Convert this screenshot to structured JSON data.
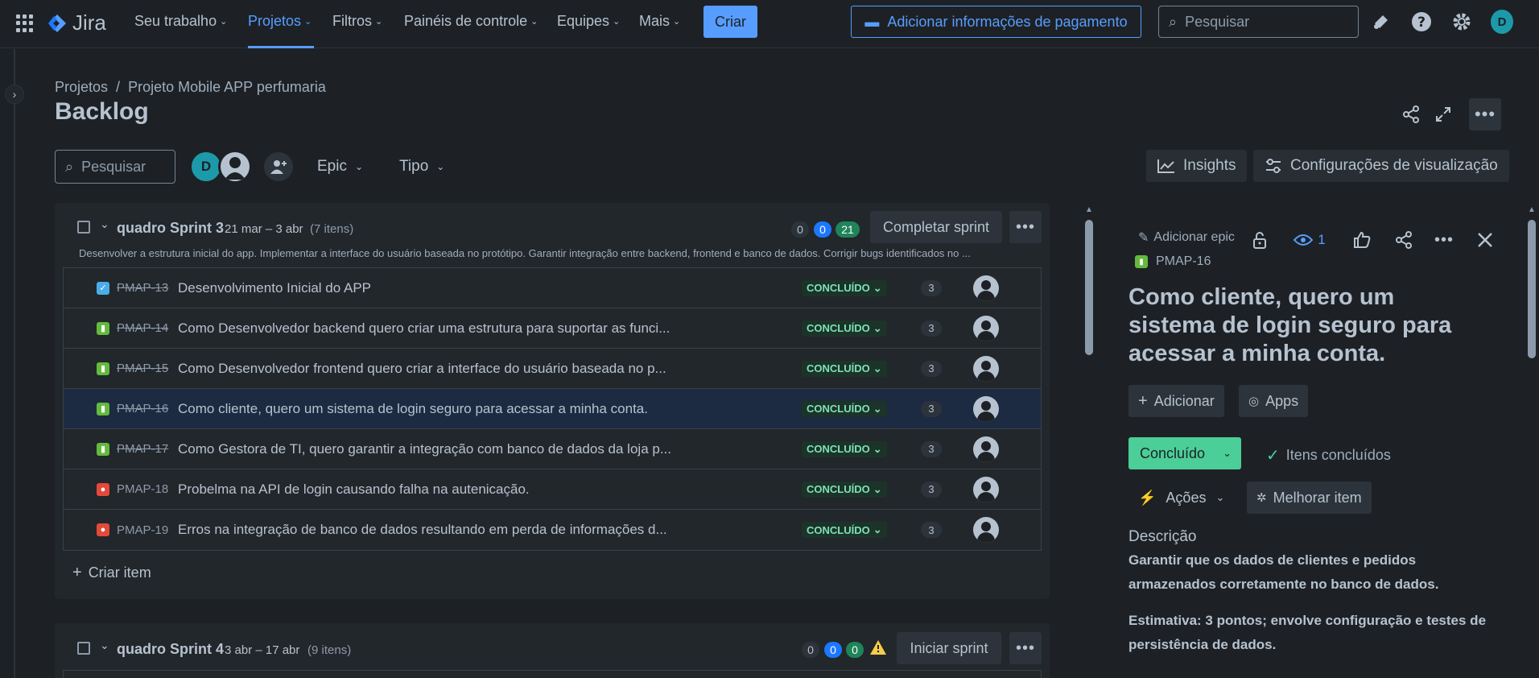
{
  "topbar": {
    "app_name": "Jira",
    "nav": [
      {
        "label": "Seu trabalho"
      },
      {
        "label": "Projetos"
      },
      {
        "label": "Filtros"
      },
      {
        "label": "Painéis de controle"
      },
      {
        "label": "Equipes"
      },
      {
        "label": "Mais"
      }
    ],
    "create_label": "Criar",
    "payment_label": "Adicionar informações de pagamento",
    "search_placeholder": "Pesquisar",
    "user_initial": "D"
  },
  "breadcrumb": {
    "root": "Projetos",
    "sep": "/",
    "project": "Projeto Mobile APP perfumaria"
  },
  "page_title": "Backlog",
  "filters": {
    "search_placeholder": "Pesquisar",
    "avatar_initial": "D",
    "epic_label": "Epic",
    "type_label": "Tipo",
    "insights_label": "Insights",
    "settings_label": "Configurações de visualização"
  },
  "sprints": [
    {
      "name": "quadro Sprint 3",
      "dates": "21 mar – 3 abr",
      "count": "(7 itens)",
      "pills": [
        "0",
        "0",
        "21"
      ],
      "action": "Completar sprint",
      "goal": "Desenvolver a estrutura inicial do app. Implementar a interface do usuário baseada no protótipo. Garantir integração entre backend, frontend e banco de dados. Corrigir bugs identificados no ...",
      "issues": [
        {
          "type": "task",
          "key": "PMAP-13",
          "title": "Desenvolvimento Inicial do APP",
          "status": "CONCLUÍDO",
          "points": "3",
          "done": true
        },
        {
          "type": "story",
          "key": "PMAP-14",
          "title": "Como Desenvolvedor backend quero criar uma estrutura para suportar as funci...",
          "status": "CONCLUÍDO",
          "points": "3",
          "done": true
        },
        {
          "type": "story",
          "key": "PMAP-15",
          "title": "Como Desenvolvedor frontend quero criar a interface do usuário baseada no p...",
          "status": "CONCLUÍDO",
          "points": "3",
          "done": true
        },
        {
          "type": "story",
          "key": "PMAP-16",
          "title": "Como cliente, quero um sistema de login seguro para acessar a minha conta.",
          "status": "CONCLUÍDO",
          "points": "3",
          "done": true
        },
        {
          "type": "story",
          "key": "PMAP-17",
          "title": "Como Gestora de TI, quero garantir a integração com banco de dados da loja p...",
          "status": "CONCLUÍDO",
          "points": "3",
          "done": true
        },
        {
          "type": "bug",
          "key": "PMAP-18",
          "title": "Probelma na API de login causando falha na autenicação.",
          "status": "CONCLUÍDO",
          "points": "3",
          "done": false
        },
        {
          "type": "bug",
          "key": "PMAP-19",
          "title": "Erros na integração de banco de dados resultando em perda de informações d...",
          "status": "CONCLUÍDO",
          "points": "3",
          "done": false
        }
      ],
      "create_label": "Criar item"
    },
    {
      "name": "quadro Sprint 4",
      "dates": "3 abr – 17 abr",
      "count": "(9 itens)",
      "pills": [
        "0",
        "0",
        "0"
      ],
      "action": "Iniciar sprint"
    }
  ],
  "panel": {
    "add_epic": "Adicionar epic",
    "key": "PMAP-16",
    "watch_count": "1",
    "title": "Como cliente, quero um sistema de login seguro para acessar a minha conta.",
    "add_label": "Adicionar",
    "apps_label": "Apps",
    "status_label": "Concluído",
    "done_label": "Itens concluídos",
    "actions_label": "Ações",
    "improve_label": "Melhorar item",
    "desc_heading": "Descrição",
    "desc_p1": "Garantir que os dados de clientes e pedidos armazenados corretamente no banco de dados.",
    "desc_p2": "Estimativa: 3 pontos; envolve configuração e testes de persistência de dados."
  },
  "colors": {
    "accent": "#579dff",
    "done": "#4bce97",
    "story": "#63ba3c",
    "bug": "#e5493a"
  }
}
